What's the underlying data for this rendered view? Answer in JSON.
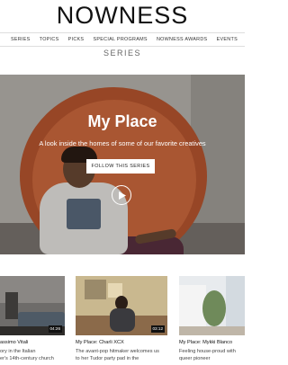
{
  "brand": {
    "logo": "NOWNESS"
  },
  "nav": {
    "items": [
      "SERIES",
      "TOPICS",
      "PICKS",
      "SPECIAL PROGRAMS",
      "NOWNESS AWARDS",
      "EVENTS"
    ]
  },
  "section_label": "SERIES",
  "hero": {
    "title": "My Place",
    "subtitle": "A look inside the homes of some of our favorite creatives",
    "follow_label": "FOLLOW THIS SERIES"
  },
  "cards": [
    {
      "title": "assimo Vitali",
      "desc_1": "ory in the Italian",
      "desc_2": "er's 14th-century church",
      "duration": "04:26"
    },
    {
      "title": "My Place: Charli XCX",
      "desc_1": "The avant-pop hitmaker welcomes us",
      "desc_2": "to her Tudor party pad in the",
      "duration": "03:12"
    },
    {
      "title": "My Place: Mykki Blanco",
      "desc_1": "Feeling house-proud with",
      "desc_2": "queer pioneer",
      "duration": ""
    }
  ]
}
